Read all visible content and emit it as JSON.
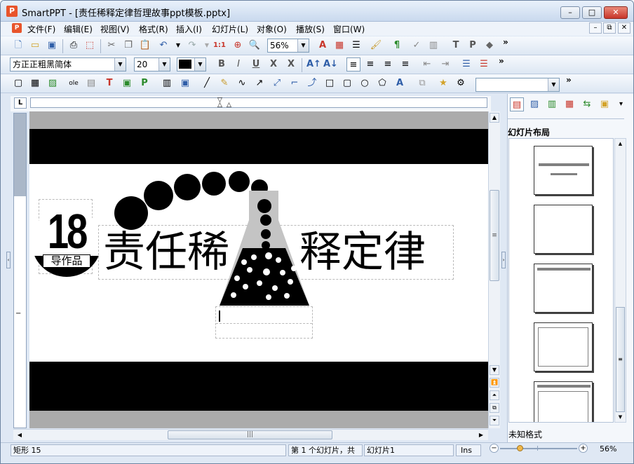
{
  "window": {
    "app_icon": "P",
    "title": "SmartPPT - [责任稀释定律哲理故事ppt模板.pptx]",
    "minimize": "–",
    "maximize": "□",
    "close": "✕"
  },
  "menubar": {
    "icon": "P",
    "items": [
      "文件(F)",
      "编辑(E)",
      "视图(V)",
      "格式(R)",
      "插入(I)",
      "幻灯片(L)",
      "对象(O)",
      "播放(S)",
      "窗口(W)"
    ],
    "mdi": [
      "–",
      "⧉",
      "✕"
    ]
  },
  "toolbar1": {
    "zoom_value": "56%",
    "more": "»"
  },
  "toolbar2": {
    "font_name": "方正正粗黑简体",
    "font_size": "20",
    "bold": "B",
    "italic": "I",
    "underline": "U",
    "strike": "X",
    "shadow": "X",
    "more": "»"
  },
  "toolbar3": {
    "more": "»"
  },
  "ruler": {
    "corner": "L"
  },
  "slide": {
    "number": "18",
    "badge": "导作品",
    "title_left": "责任稀",
    "title_right": "释定律"
  },
  "scroll": {
    "grip": "≡",
    "hgrip": "|||"
  },
  "panel": {
    "title": "幻灯片布局",
    "format": "未知格式",
    "more": "▾"
  },
  "status": {
    "shape": "矩形 15",
    "slide_pos": "第 1 个幻灯片，共",
    "slide_name": "幻灯片1",
    "ins": "Ins",
    "zoom": "56%",
    "zoom_minus": "−",
    "zoom_plus": "+"
  },
  "colors": {
    "title_blue": "#dfe8f4",
    "close_red": "#c8352a",
    "app_orange": "#e8542b",
    "slide_band": "#000000"
  }
}
